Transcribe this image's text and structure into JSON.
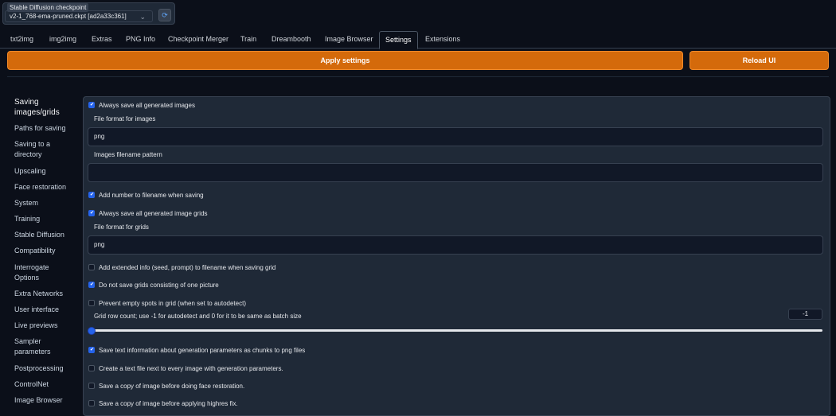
{
  "checkpoint": {
    "label": "Stable Diffusion checkpoint",
    "value": "v2-1_768-ema-pruned.ckpt [ad2a33c361]",
    "refresh_icon": "refresh-icon"
  },
  "tabs": [
    "txt2img",
    "img2img",
    "Extras",
    "PNG Info",
    "Checkpoint Merger",
    "Train",
    "Dreambooth",
    "Image Browser",
    "Settings",
    "Extensions"
  ],
  "active_tab": "Settings",
  "buttons": {
    "apply": "Apply settings",
    "reload": "Reload UI"
  },
  "accent_color": "#d46a0b",
  "sidebar": [
    "Saving images/grids",
    "Paths for saving",
    "Saving to a directory",
    "Upscaling",
    "Face restoration",
    "System",
    "Training",
    "Stable Diffusion",
    "Compatibility",
    "Interrogate Options",
    "Extra Networks",
    "User interface",
    "Live previews",
    "Sampler parameters",
    "Postprocessing",
    "ControlNet",
    "Image Browser"
  ],
  "settings": {
    "always_save_images": "Always save all generated images",
    "file_format_images_label": "File format for images",
    "file_format_images_value": "png",
    "filename_pattern_label": "Images filename pattern",
    "filename_pattern_value": "",
    "add_number": "Add number to filename when saving",
    "always_save_grids": "Always save all generated image grids",
    "file_format_grids_label": "File format for grids",
    "file_format_grids_value": "png",
    "add_extended_info": "Add extended info (seed, prompt) to filename when saving grid",
    "no_single_grid": "Do not save grids consisting of one picture",
    "prevent_empty": "Prevent empty spots in grid (when set to autodetect)",
    "grid_row_label": "Grid row count; use -1 for autodetect and 0 for it to be same as batch size",
    "grid_row_value": "-1",
    "save_text_chunks": "Save text information about generation parameters as chunks to png files",
    "create_text_file": "Create a text file next to every image with generation parameters.",
    "save_before_face": "Save a copy of image before doing face restoration.",
    "save_before_highres": "Save a copy of image before applying highres fix."
  }
}
